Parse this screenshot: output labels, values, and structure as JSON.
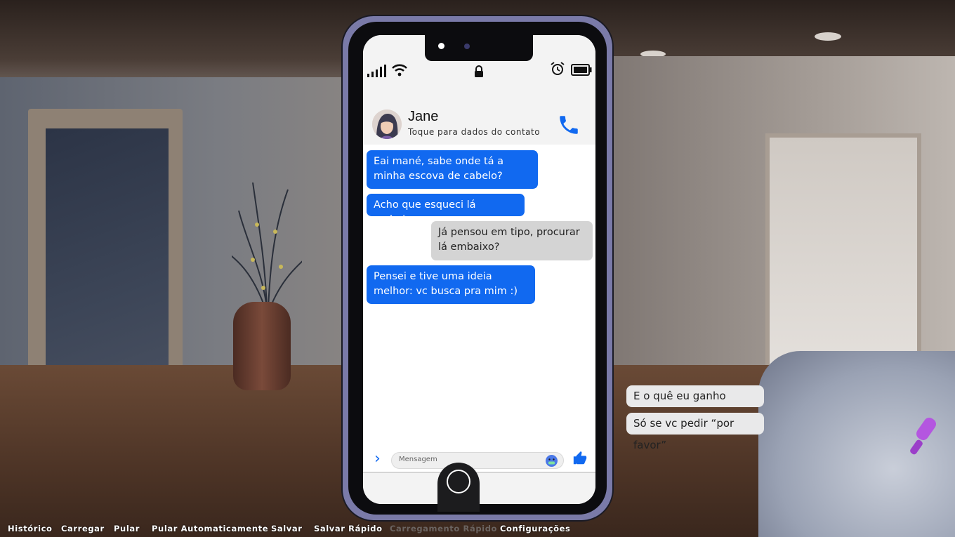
{
  "contact": {
    "name": "Jane",
    "subtitle": "Toque para dados do contato"
  },
  "messages": [
    {
      "side": "in",
      "text": "Eai mané, sabe onde tá a minha escova de cabelo?"
    },
    {
      "side": "in",
      "text": "Acho que esqueci lá embaixo"
    },
    {
      "side": "out",
      "text": "Já pensou em tipo, procurar lá embaixo?"
    },
    {
      "side": "in",
      "text": "Pensei e tive uma ideia melhor: vc busca pra mim :)"
    }
  ],
  "composer": {
    "placeholder": "Mensagem"
  },
  "choices": [
    "E o quê eu ganho nisso?",
    "Só se vc pedir “por favor”"
  ],
  "quick_menu": [
    {
      "label": "Histórico",
      "enabled": true
    },
    {
      "label": "Carregar",
      "enabled": true
    },
    {
      "label": "Pular",
      "enabled": true
    },
    {
      "label": "Pular Automaticamente",
      "enabled": true
    },
    {
      "label": "Salvar",
      "enabled": true
    },
    {
      "label": "Salvar Rápido",
      "enabled": true
    },
    {
      "label": "Carregamento Rápido",
      "enabled": false
    },
    {
      "label": "Configurações",
      "enabled": true
    }
  ],
  "colors": {
    "incoming_bubble": "#1169f0",
    "outgoing_bubble": "#d4d4d4",
    "accent": "#1169f0"
  }
}
